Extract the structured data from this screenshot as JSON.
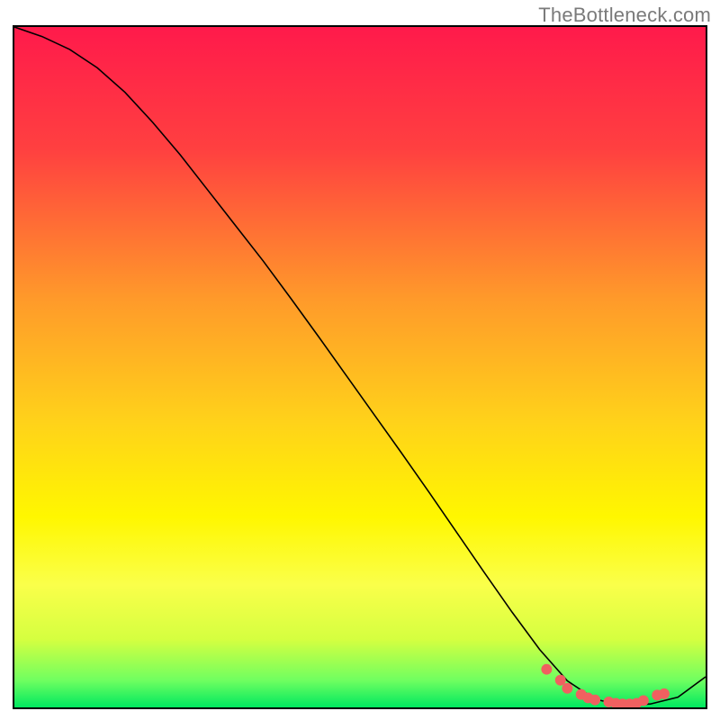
{
  "watermark": {
    "text": "TheBottleneck.com"
  },
  "chart_data": {
    "type": "line",
    "title": "",
    "xlabel": "",
    "ylabel": "",
    "xlim": [
      0,
      100
    ],
    "ylim": [
      0,
      100
    ],
    "series": [
      {
        "name": "curve",
        "color": "#000000",
        "stroke_width": 1.6,
        "x": [
          0,
          4,
          8,
          12,
          16,
          20,
          24,
          28,
          32,
          36,
          40,
          44,
          48,
          52,
          56,
          60,
          64,
          68,
          72,
          76,
          80,
          84,
          88,
          92,
          96,
          100
        ],
        "y": [
          100,
          98.6,
          96.7,
          94.0,
          90.4,
          86.0,
          81.2,
          76.0,
          70.8,
          65.6,
          60.1,
          54.5,
          48.8,
          43.1,
          37.4,
          31.6,
          25.7,
          19.8,
          14.0,
          8.5,
          3.9,
          1.2,
          0.3,
          0.5,
          1.5,
          4.5
        ]
      },
      {
        "name": "dots",
        "color": "#f06060",
        "type_override": "scatter",
        "radius": 6,
        "x": [
          77,
          79,
          80,
          82,
          83,
          84,
          86,
          87,
          88,
          89,
          90,
          91,
          93,
          94
        ],
        "y": [
          5.6,
          4.0,
          2.8,
          1.9,
          1.4,
          1.1,
          0.8,
          0.6,
          0.5,
          0.5,
          0.6,
          1.0,
          1.8,
          2.0
        ]
      }
    ],
    "background_gradient": {
      "stops": [
        {
          "offset": 0.0,
          "color": "#ff1a4b"
        },
        {
          "offset": 0.18,
          "color": "#ff4040"
        },
        {
          "offset": 0.4,
          "color": "#ff9a2a"
        },
        {
          "offset": 0.58,
          "color": "#ffd21a"
        },
        {
          "offset": 0.72,
          "color": "#fff700"
        },
        {
          "offset": 0.82,
          "color": "#faff4a"
        },
        {
          "offset": 0.9,
          "color": "#d5ff40"
        },
        {
          "offset": 0.96,
          "color": "#70ff60"
        },
        {
          "offset": 1.0,
          "color": "#00e860"
        }
      ]
    }
  }
}
